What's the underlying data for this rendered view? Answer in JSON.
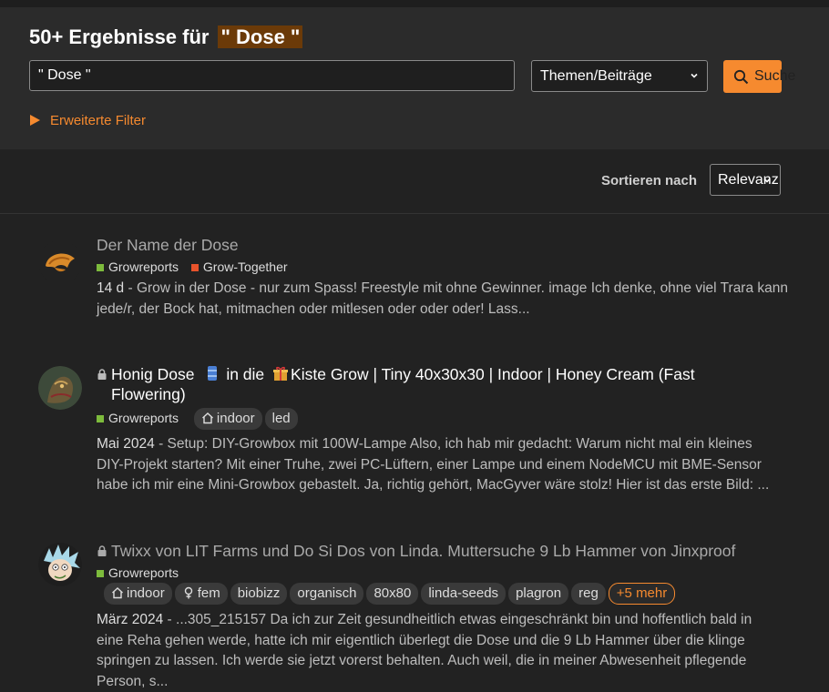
{
  "search": {
    "heading_prefix": "50+ Ergebnisse für",
    "heading_term": "\" Dose \"",
    "query": "\" Dose \"",
    "type_selected": "Themen/Beiträge",
    "button_label": "Suche",
    "advanced_filter_label": "Erweiterte Filter"
  },
  "sort": {
    "label": "Sortieren nach",
    "selected": "Relevanz"
  },
  "results": [
    {
      "title": "Der Name der Dose",
      "categories": [
        {
          "name": "Growreports",
          "color": "#7dbb3c"
        },
        {
          "name": "Grow-Together",
          "color": "#e8532b"
        }
      ],
      "date": "14 d",
      "excerpt": "Grow in der Dose - nur zum Spass! Freestyle mit ohne Gewinner. image Ich denke, ohne viel Trara kann jede/r, der Bock hat, mitmachen oder mitlesen oder oder oder! Lass..."
    },
    {
      "title_part1": "Honig Dose",
      "title_part2": "in die",
      "title_part3": "Kiste Grow | Tiny 40x30x30 | Indoor | Honey Cream (Fast",
      "title_part4": "Flowering)",
      "categories": [
        {
          "name": "Growreports",
          "color": "#7dbb3c"
        }
      ],
      "tags": [
        "indoor",
        "led"
      ],
      "date": "Mai 2024",
      "excerpt_lines": [
        "Setup: DIY-Growbox mit 100W-Lampe Also, ich hab mir gedacht: Warum nicht mal ein kleines",
        "DIY-Projekt starten? Mit einer Truhe, zwei PC-Lüftern, einer Lampe und einem NodeMCU mit BME-Sensor",
        "habe ich mir eine Mini-Growbox gebastelt. Ja, richtig gehört, MacGyver wäre stolz! Hier ist das erste Bild: ..."
      ]
    },
    {
      "title": "Twixx von LIT Farms und Do Si Dos von Linda. Muttersuche 9 Lb Hammer von Jinxproof",
      "categories": [
        {
          "name": "Growreports",
          "color": "#7dbb3c"
        }
      ],
      "tags": [
        "indoor",
        "fem",
        "biobizz",
        "organisch",
        "80x80",
        "linda-seeds",
        "plagron",
        "reg"
      ],
      "more_tags": "+5 mehr",
      "date": "März 2024",
      "excerpt_lines": [
        "...305_215157 Da ich zur Zeit gesundheitlich etwas eingeschränkt bin und hoffentlich bald in",
        "eine Reha gehen werde, hatte ich mir eigentlich überlegt die Dose und die 9 Lb Hammer über die klinge",
        "springen zu lassen. Ich werde sie jetzt vorerst behalten. Auch weil, die in meiner Abwesenheit pflegende",
        "Person, s..."
      ]
    }
  ],
  "colors": {
    "accent": "#f68a2f",
    "highlight": "#6b3a08",
    "background": "#222222"
  }
}
